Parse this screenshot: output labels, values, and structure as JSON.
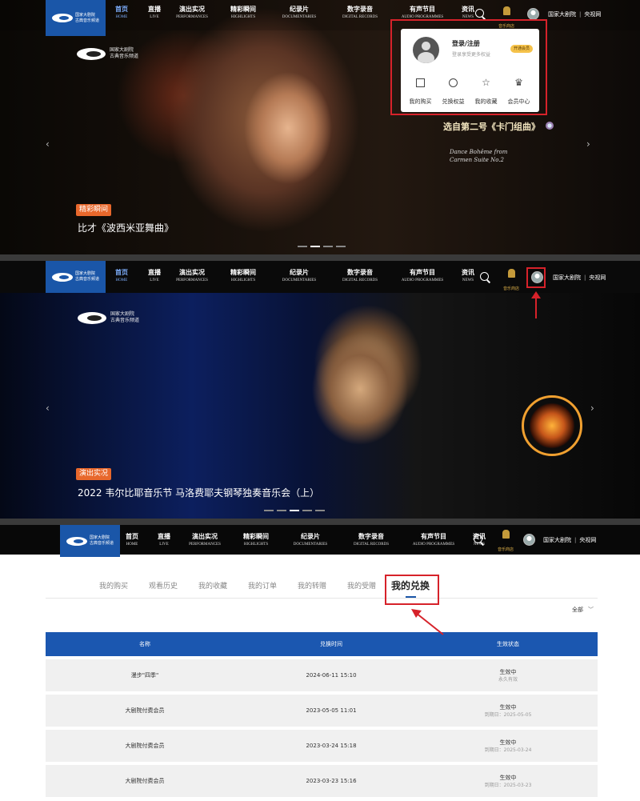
{
  "colors": {
    "brand_blue": "#1a56a8",
    "table_header": "#1b57b0",
    "tag_orange": "#e8682c",
    "annotation_red": "#d6222a"
  },
  "logo": {
    "line1": "国家大剧院",
    "line2": "古典音乐频道"
  },
  "nav": {
    "items": [
      {
        "cn": "首页",
        "en": "HOME"
      },
      {
        "cn": "直播",
        "en": "LIVE"
      },
      {
        "cn": "演出实况",
        "en": "PERFORMANCES"
      },
      {
        "cn": "精彩瞬间",
        "en": "HIGHLIGHTS"
      },
      {
        "cn": "纪录片",
        "en": "DOCUMENTARIES"
      },
      {
        "cn": "数字录音",
        "en": "DIGITAL RECORDS"
      },
      {
        "cn": "有声节目",
        "en": "AUDIO PROGRAMMES"
      },
      {
        "cn": "资讯",
        "en": "NEWS"
      }
    ],
    "store_label": "音乐商店",
    "link_ncpa": "国家大剧院",
    "link_sep": "|",
    "link_cctv": "央视网",
    "search_icon": "search-icon",
    "avatar_icon": "user-avatar-icon"
  },
  "banner1": {
    "tag": "精彩瞬间",
    "caption": "比才《波西米亚舞曲》",
    "overlay_title": "选自第二号《卡门组曲》",
    "overlay_script_1": "Dance Bohême from",
    "overlay_script_2": "Carmen Suite No.2"
  },
  "popup": {
    "login": "登录/注册",
    "subtitle": "登录享受更多权益",
    "vip_button": "开通会员",
    "menu": [
      {
        "label": "我的购买",
        "icon": "purchase-icon"
      },
      {
        "label": "兑换权益",
        "icon": "redeem-icon"
      },
      {
        "label": "我的收藏",
        "icon": "star-icon"
      },
      {
        "label": "会员中心",
        "icon": "crown-icon"
      }
    ]
  },
  "banner2": {
    "tag": "演出实况",
    "caption": "2022 韦尔比耶音乐节 马洛费耶夫钢琴独奏音乐会（上）"
  },
  "account": {
    "tabs": [
      "我的购买",
      "观看历史",
      "我的收藏",
      "我的订单",
      "我的转赠",
      "我的受赠",
      "我的兑换"
    ],
    "active_tab": "我的兑换",
    "filter": "全部",
    "table": {
      "headers": [
        "名称",
        "兑换时间",
        "生效状态"
      ],
      "rows": [
        {
          "name": "漫步\"四季\"",
          "time": "2024-06-11 15:10",
          "status": "生效中",
          "expiry": "永久有效"
        },
        {
          "name": "大剧院付费会员",
          "time": "2023-05-05 11:01",
          "status": "生效中",
          "expiry": "到期日：2025-05-05"
        },
        {
          "name": "大剧院付费会员",
          "time": "2023-03-24 15:18",
          "status": "生效中",
          "expiry": "到期日：2025-03-24"
        },
        {
          "name": "大剧院付费会员",
          "time": "2023-03-23 15:16",
          "status": "生效中",
          "expiry": "到期日：2025-03-23"
        }
      ]
    }
  }
}
